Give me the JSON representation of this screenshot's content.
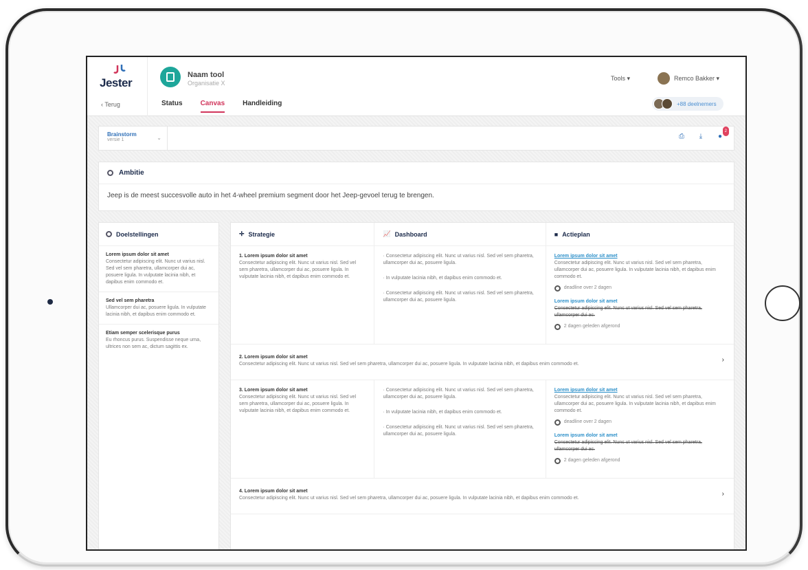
{
  "app": {
    "logo_text": "Jester",
    "back_label": "Terug",
    "tool_name": "Naam tool",
    "org_name": "Organisatie X",
    "tabs": [
      {
        "label": "Status"
      },
      {
        "label": "Canvas"
      },
      {
        "label": "Handleiding"
      }
    ],
    "active_tab": "Canvas",
    "tools_menu": "Tools ▾",
    "user_name": "Remco Bakker ▾",
    "participants": "+88 deelnemers",
    "accent_color": "#d1355b",
    "brand_color": "#1ea69a"
  },
  "toolbar": {
    "version_name": "Brainstorm",
    "version_sub": "versie 1",
    "icons": [
      "print-icon",
      "download-icon",
      "comment-icon"
    ],
    "comment_badge": "2"
  },
  "ambitie": {
    "title": "Ambitie",
    "text": "Jeep is de meest succesvolle auto in het 4-wheel premium segment door het Jeep-gevoel terug te brengen."
  },
  "doelstellingen": {
    "title": "Doelstellingen",
    "items": [
      {
        "title": "Lorem ipsum dolor sit amet",
        "text": "Consectetur adipiscing elit. Nunc ut varius nisl. Sed vel sem pharetra, ullamcorper dui ac, posuere ligula. In vulputate lacinia nibh, et dapibus enim commodo et."
      },
      {
        "title": "Sed vel sem pharetra",
        "text": "Ullamcorper dui ac, posuere ligula. In vulputate lacinia nibh, et dapibus enim commodo et."
      },
      {
        "title": "Etiam semper scelerisque purus",
        "text": "Eu rhoncus purus. Suspendisse neque urna, ultrices non sem ac, dictum sagittis ex."
      }
    ]
  },
  "grid": {
    "headers": {
      "strategie": "Strategie",
      "dashboard": "Dashboard",
      "actieplan": "Actieplan"
    },
    "rows": [
      {
        "strategie_title": "1. Lorem ipsum dolor sit amet",
        "strategie_text": "Consectetur adipiscing elit. Nunc ut varius nisl. Sed vel sem pharetra, ullamcorper dui ac, posuere ligula. In vulputate lacinia nibh, et dapibus enim commodo et.",
        "dashboard": [
          "Consectetur adipiscing elit. Nunc ut varius nisl. Sed vel sem pharetra, ullamcorper dui ac, posuere ligula.",
          "In vulputate lacinia nibh, et dapibus enim commodo et.",
          "Consectetur adipiscing elit. Nunc ut varius nisl. Sed vel sem pharetra, ullamcorper dui ac, posuere ligula."
        ],
        "action1_link": "Lorem ipsum dolor sit amet",
        "action1_text": "Consectetur adipiscing elit. Nunc ut varius nisl. Sed vel sem pharetra, ullamcorper dui ac, posuere ligula. In vulputate lacinia nibh, et dapibus enim commodo et.",
        "action1_deadline": "deadline over 2 dagen",
        "action2_link": "Lorem ipsum dolor sit amet",
        "action2_text": "Consectetur adipiscing elit. Nunc ut varius nisl. Sed vel sem pharetra, ullamcorper dui ac.",
        "action2_done": "2 dagen geleden afgerond"
      },
      {
        "collapsed_title": "2. Lorem ipsum dolor sit amet",
        "collapsed_text": "Consectetur adipiscing elit. Nunc ut varius nisl. Sed vel sem pharetra, ullamcorper dui ac, posuere ligula. In vulputate lacinia nibh, et dapibus enim commodo et."
      },
      {
        "strategie_title": "3. Lorem ipsum dolor sit amet",
        "strategie_text": "Consectetur adipiscing elit. Nunc ut varius nisl. Sed vel sem pharetra, ullamcorper dui ac, posuere ligula. In vulputate lacinia nibh, et dapibus enim commodo et.",
        "dashboard": [
          "Consectetur adipiscing elit. Nunc ut varius nisl. Sed vel sem pharetra, ullamcorper dui ac, posuere ligula.",
          "In vulputate lacinia nibh, et dapibus enim commodo et.",
          "Consectetur adipiscing elit. Nunc ut varius nisl. Sed vel sem pharetra, ullamcorper dui ac, posuere ligula."
        ],
        "action1_link": "Lorem ipsum dolor sit amet",
        "action1_text": "Consectetur adipiscing elit. Nunc ut varius nisl. Sed vel sem pharetra, ullamcorper dui ac, posuere ligula. In vulputate lacinia nibh, et dapibus enim commodo et.",
        "action1_deadline": "deadline over 2 dagen",
        "action2_link": "Lorem ipsum dolor sit amet",
        "action2_text": "Consectetur adipiscing elit. Nunc ut varius nisl. Sed vel sem pharetra, ullamcorper dui ac.",
        "action2_done": "2 dagen geleden afgerond"
      },
      {
        "collapsed_title": "4. Lorem ipsum dolor sit amet",
        "collapsed_text": "Consectetur adipiscing elit. Nunc ut varius nisl. Sed vel sem pharetra, ullamcorper dui ac, posuere ligula. In vulputate lacinia nibh, et dapibus enim commodo et."
      }
    ]
  }
}
